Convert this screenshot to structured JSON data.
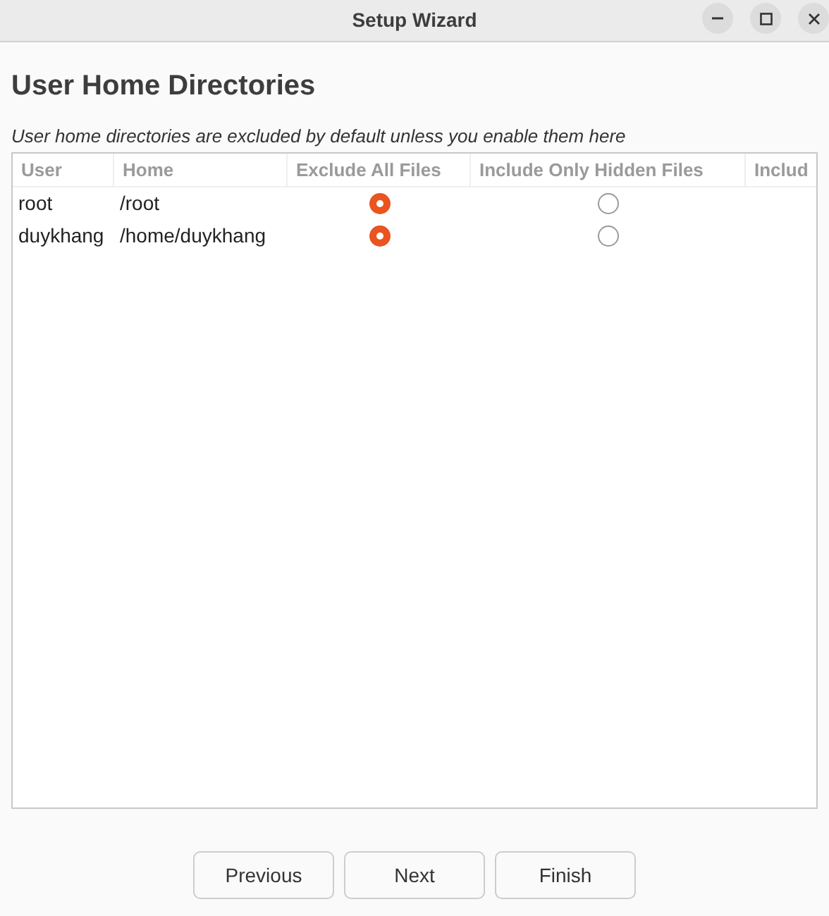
{
  "window": {
    "title": "Setup Wizard"
  },
  "page": {
    "heading": "User Home Directories",
    "description": "User home directories are excluded by default unless you enable them here"
  },
  "table": {
    "columns": [
      "User",
      "Home",
      "Exclude All Files",
      "Include Only Hidden Files",
      "Includ"
    ],
    "rows": [
      {
        "user": "root",
        "home": "/root",
        "options": [
          {
            "selected": true
          },
          {
            "selected": false
          }
        ]
      },
      {
        "user": "duykhang",
        "home": "/home/duykhang",
        "options": [
          {
            "selected": true
          },
          {
            "selected": false
          }
        ]
      }
    ]
  },
  "buttons": [
    "Previous",
    "Next",
    "Finish"
  ]
}
